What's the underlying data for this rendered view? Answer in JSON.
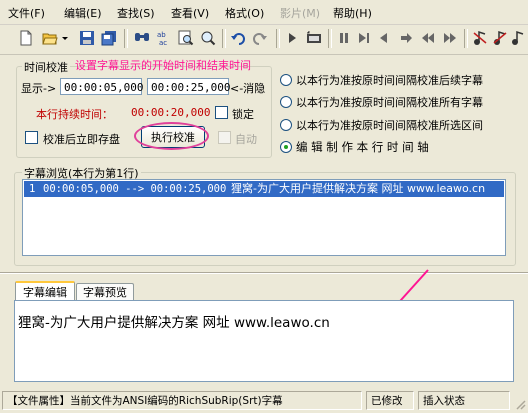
{
  "menu": [
    {
      "label": "文件(F)",
      "enabled": true
    },
    {
      "label": "编辑(E)",
      "enabled": true
    },
    {
      "label": "查找(S)",
      "enabled": true
    },
    {
      "label": "查看(V)",
      "enabled": true
    },
    {
      "label": "格式(O)",
      "enabled": true
    },
    {
      "label": "影片(M)",
      "enabled": false
    },
    {
      "label": "帮助(H)",
      "enabled": true
    }
  ],
  "toolbar_icons": [
    "new-icon",
    "open-icon",
    "dropdown-icon",
    "save-icon",
    "save-all-icon",
    "find-icon",
    "replace-icon",
    "search-icon",
    "preview-icon",
    "undo-icon",
    "redo-icon",
    "play-icon",
    "film-icon",
    "pause-icon",
    "step-icon",
    "prev-icon",
    "next-icon",
    "rewind-icon",
    "forward-icon",
    "music-icon-1",
    "music-icon-2",
    "music-icon-3"
  ],
  "timing": {
    "legend": "时间校准",
    "annotation": "设置字幕显示的开始时间和结束时间",
    "display_label": "显示->",
    "start_time": "00:00:05,000",
    "end_time": "00:00:25,000",
    "hide_label": "<-消隐",
    "duration_label": "本行持续时间：",
    "duration_value": "00:00:20,000",
    "lock_label": "锁定",
    "save_after_label": "校准后立即存盘",
    "execute_label": "执行校准",
    "auto_label": "自动"
  },
  "radio_options": [
    {
      "label": "以本行为准按原时间间隔校准后续字幕",
      "selected": false
    },
    {
      "label": "以本行为准按原时间间隔校准所有字幕",
      "selected": false
    },
    {
      "label": "以本行为准按原时间间隔校准所选区间",
      "selected": false
    },
    {
      "label": "编 辑 制 作 本 行 时 间 轴",
      "selected": true
    }
  ],
  "browse": {
    "legend": "字幕浏览(本行为第1行)",
    "rows": [
      {
        "index": "1",
        "time": "00:00:05,000 --> 00:00:25,000",
        "text": "狸窝-为广大用户提供解决方案 网址 www.leawo.cn"
      }
    ]
  },
  "tabs": [
    {
      "label": "字幕编辑",
      "active": true
    },
    {
      "label": "字幕预览",
      "active": false
    }
  ],
  "editor_text": "狸窝-为广大用户提供解决方案 网址 www.leawo.cn",
  "status": {
    "file_info": "【文件属性】当前文件为ANSI编码的RichSubRip(Srt)字幕",
    "modified": "已修改",
    "insert_mode": "插入状态"
  },
  "colors": {
    "accent": "#316ac5",
    "annotation": "#ff1493",
    "duration": "#c00000",
    "tab_highlight": "#ffc83c"
  }
}
